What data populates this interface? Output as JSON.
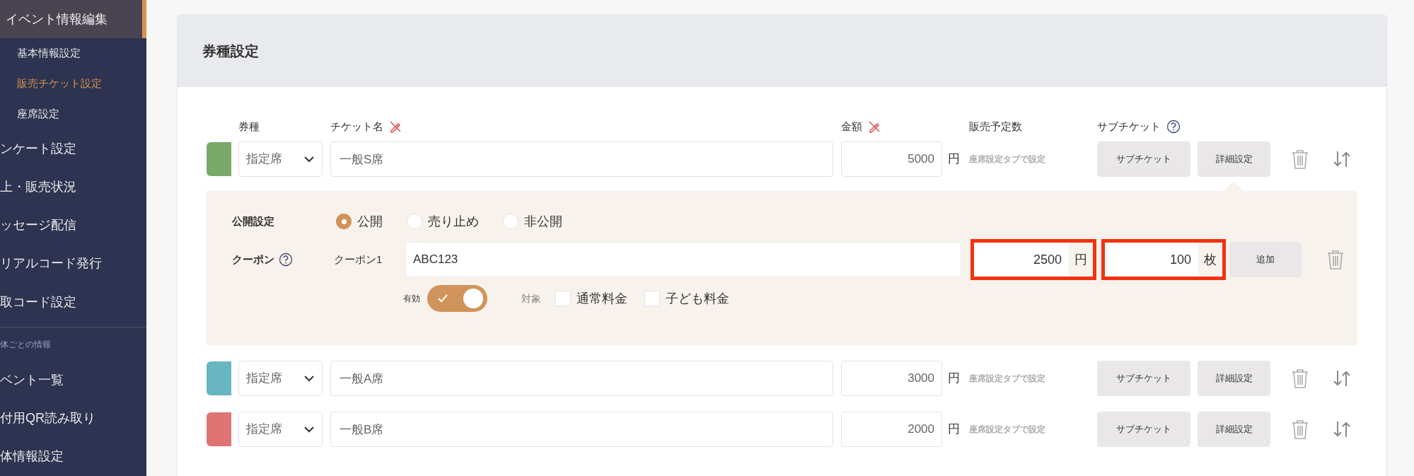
{
  "sidebar": {
    "items": [
      {
        "label": "イベント情報編集",
        "kind": "section",
        "selected": true
      },
      {
        "label": "基本情報設定",
        "kind": "sub",
        "selected": false
      },
      {
        "label": "販売チケット設定",
        "kind": "sub",
        "selected": true
      },
      {
        "label": "座席設定",
        "kind": "sub",
        "selected": false
      },
      {
        "label": "ンケート設定",
        "kind": "main",
        "selected": false
      },
      {
        "label": "上・販売状況",
        "kind": "main",
        "selected": false
      },
      {
        "label": "ッセージ配信",
        "kind": "main",
        "selected": false
      },
      {
        "label": "リアルコード発行",
        "kind": "main",
        "selected": false
      },
      {
        "label": "取コード設定",
        "kind": "main",
        "selected": false
      },
      {
        "label": "体ごとの情報",
        "kind": "heading",
        "selected": false
      },
      {
        "label": "ベント一覧",
        "kind": "main",
        "selected": false
      },
      {
        "label": "付用QR読み取り",
        "kind": "main",
        "selected": false
      },
      {
        "label": "体情報設定",
        "kind": "main",
        "selected": false
      }
    ]
  },
  "card": {
    "title": "券種設定",
    "columns": {
      "type": "券種",
      "name": "チケット名",
      "price": "金額",
      "planned": "販売予定数",
      "sub": "サブチケット"
    },
    "tickets": [
      {
        "color": "#7aa96a",
        "type": "指定席",
        "name": "一般S席",
        "price": "5000",
        "unit": "円",
        "planned": "座席設定タブで設定",
        "sub_button": "サブチケット",
        "detail_button": "詳細設定",
        "expanded": true
      },
      {
        "color": "#67b6c1",
        "type": "指定席",
        "name": "一般A席",
        "price": "3000",
        "unit": "円",
        "planned": "座席設定タブで設定",
        "sub_button": "サブチケット",
        "detail_button": "詳細設定",
        "expanded": false
      },
      {
        "color": "#e07474",
        "type": "指定席",
        "name": "一般B席",
        "price": "2000",
        "unit": "円",
        "planned": "座席設定タブで設定",
        "sub_button": "サブチケット",
        "detail_button": "詳細設定",
        "expanded": false
      }
    ],
    "detail": {
      "visibility_label": "公開設定",
      "visibility_options": [
        {
          "label": "公開",
          "selected": true
        },
        {
          "label": "売り止め",
          "selected": false
        },
        {
          "label": "非公開",
          "selected": false
        }
      ],
      "coupon_label": "クーポン",
      "coupon_name": "クーポン1",
      "coupon_code": "ABC123",
      "discount": "2500",
      "discount_unit": "円",
      "quantity": "100",
      "quantity_unit": "枚",
      "add_button": "追加",
      "enabled_label": "有効",
      "enabled": true,
      "target_label": "対象",
      "targets": [
        {
          "label": "通常料金",
          "checked": false
        },
        {
          "label": "子ども料金",
          "checked": false
        }
      ]
    }
  }
}
